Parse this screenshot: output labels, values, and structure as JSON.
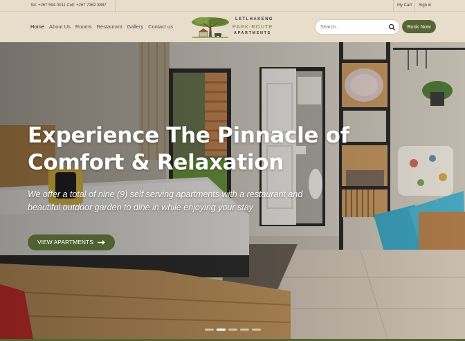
{
  "topbar": {
    "contact": "Tel: +267 594 0011  Cell: +267 7362 3887",
    "my_cart": "My Cart",
    "sign_in": "Sign in"
  },
  "nav": {
    "items": [
      "Home",
      "About Us",
      "Rooms",
      "Restaurant",
      "Gallery",
      "Contact us"
    ],
    "active": "Home"
  },
  "logo": {
    "line1": "LETLHAKENG",
    "line2": "PARK-ROUTE",
    "line3": "APARTMENTS"
  },
  "search": {
    "placeholder": "Search...",
    "icon": "search-icon"
  },
  "book_button": "Book Now",
  "hero": {
    "headline_line1": "Experience The Pinnacle of",
    "headline_line2": "Comfort & Relaxation",
    "subtext": "We offer a total of nine (9) self serving apartments with a restaurant and beautiful outdoor garden to dine in while enjoying your stay",
    "cta_label": "VIEW APARTMENTS",
    "cta_icon": "arrow-right-icon",
    "slides": 5,
    "active_slide": 2
  },
  "colors": {
    "brand_green": "#556633",
    "header_bg": "#e8dccb",
    "logo_green": "#6b8b3c"
  }
}
